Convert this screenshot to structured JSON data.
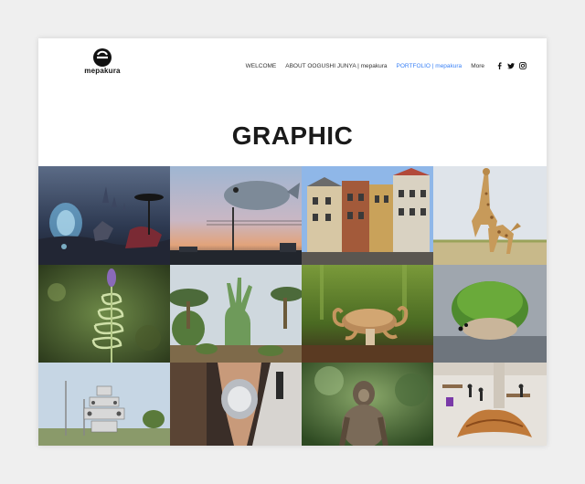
{
  "brand": {
    "name": "mepakura"
  },
  "nav": {
    "items": [
      {
        "label": "WELCOME",
        "active": false
      },
      {
        "label": "ABOUT OOGUSHI JUNYA | mepakura",
        "active": false
      },
      {
        "label": "PORTFOLIO | mepakura",
        "active": true
      },
      {
        "label": "More",
        "active": false
      }
    ],
    "social": [
      "facebook-icon",
      "twitter-icon",
      "instagram-icon"
    ]
  },
  "page": {
    "title": "GRAPHIC"
  },
  "colors": {
    "accent": "#3b82f6",
    "text": "#1a1a1a",
    "background": "#efefef"
  },
  "gallery": {
    "tiles": [
      {
        "name": "alien-landscape-artwork"
      },
      {
        "name": "flying-fish-sunset-artwork"
      },
      {
        "name": "colorful-townhouses-artwork"
      },
      {
        "name": "giraffe-balance-artwork"
      },
      {
        "name": "lavender-spiral-artwork"
      },
      {
        "name": "cactus-hand-artwork"
      },
      {
        "name": "octopus-mushroom-artwork"
      },
      {
        "name": "moss-hedgehog-artwork"
      },
      {
        "name": "robot-tower-artwork"
      },
      {
        "name": "runway-model-artwork"
      },
      {
        "name": "monkey-forest-artwork"
      },
      {
        "name": "giant-croissant-artwork"
      }
    ]
  }
}
